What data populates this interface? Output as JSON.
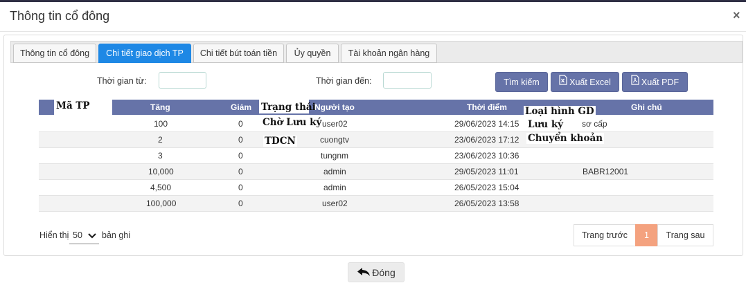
{
  "modal": {
    "title": "Thông tin cổ đông",
    "close_symbol": "×"
  },
  "tabs": [
    {
      "label": "Thông tin cổ đông",
      "active": false
    },
    {
      "label": "Chi tiết giao dịch TP",
      "active": true
    },
    {
      "label": "Chi tiết bút toán tiền",
      "active": false
    },
    {
      "label": "Ủy quyền",
      "active": false
    },
    {
      "label": "Tài khoản ngân hàng",
      "active": false
    }
  ],
  "filter": {
    "from_label": "Thời gian từ:",
    "from_value": "",
    "to_label": "Thời gian đến:",
    "to_value": ""
  },
  "actions": {
    "search": "Tìm kiếm",
    "export_excel": "Xuất Excel",
    "export_pdf": "Xuất PDF"
  },
  "table": {
    "header_overlay": {
      "ma_tp": "Mã TP",
      "trang_thai": "Trạng thái",
      "loai_hinh_gd": "Loại hình GD"
    },
    "columns": {
      "tang": "Tăng",
      "giam": "Giảm",
      "nguoi_tao": "Người tạo",
      "thoi_diem": "Thời điểm",
      "ghi_chu": "Ghi chú"
    },
    "rows": [
      {
        "tang": "100",
        "giam": "0",
        "trang_thai": "Chờ Lưu ký",
        "nguoi_tao": "user02",
        "thoi_diem": "29/06/2023 14:15",
        "loai_hinh_gd": "Lưu ký",
        "ghi_chu": "sơ cấp"
      },
      {
        "tang": "2",
        "giam": "0",
        "trang_thai": "TDCN",
        "nguoi_tao": "cuongtv",
        "thoi_diem": "23/06/2023 17:12",
        "loai_hinh_gd": "Chuyển khoản",
        "ghi_chu": ""
      },
      {
        "tang": "3",
        "giam": "0",
        "trang_thai": "",
        "nguoi_tao": "tungnm",
        "thoi_diem": "23/06/2023 10:36",
        "loai_hinh_gd": "",
        "ghi_chu": ""
      },
      {
        "tang": "10,000",
        "giam": "0",
        "trang_thai": "",
        "nguoi_tao": "admin",
        "thoi_diem": "29/05/2023 11:01",
        "loai_hinh_gd": "",
        "ghi_chu": "BABR12001"
      },
      {
        "tang": "4,500",
        "giam": "0",
        "trang_thai": "",
        "nguoi_tao": "admin",
        "thoi_diem": "26/05/2023 15:04",
        "loai_hinh_gd": "",
        "ghi_chu": ""
      },
      {
        "tang": "100,000",
        "giam": "0",
        "trang_thai": "",
        "nguoi_tao": "user02",
        "thoi_diem": "26/05/2023 13:58",
        "loai_hinh_gd": "",
        "ghi_chu": ""
      }
    ]
  },
  "paging": {
    "show_label": "Hiển thị",
    "page_size": "50",
    "records_label": "bản ghi",
    "prev": "Trang trước",
    "current_page": "1",
    "next": "Trang sau"
  },
  "footer": {
    "close_label": "Đóng"
  },
  "colors": {
    "accent": "#6673a8",
    "active_tab": "#1e88e5",
    "current_page": "#f4a27f"
  }
}
